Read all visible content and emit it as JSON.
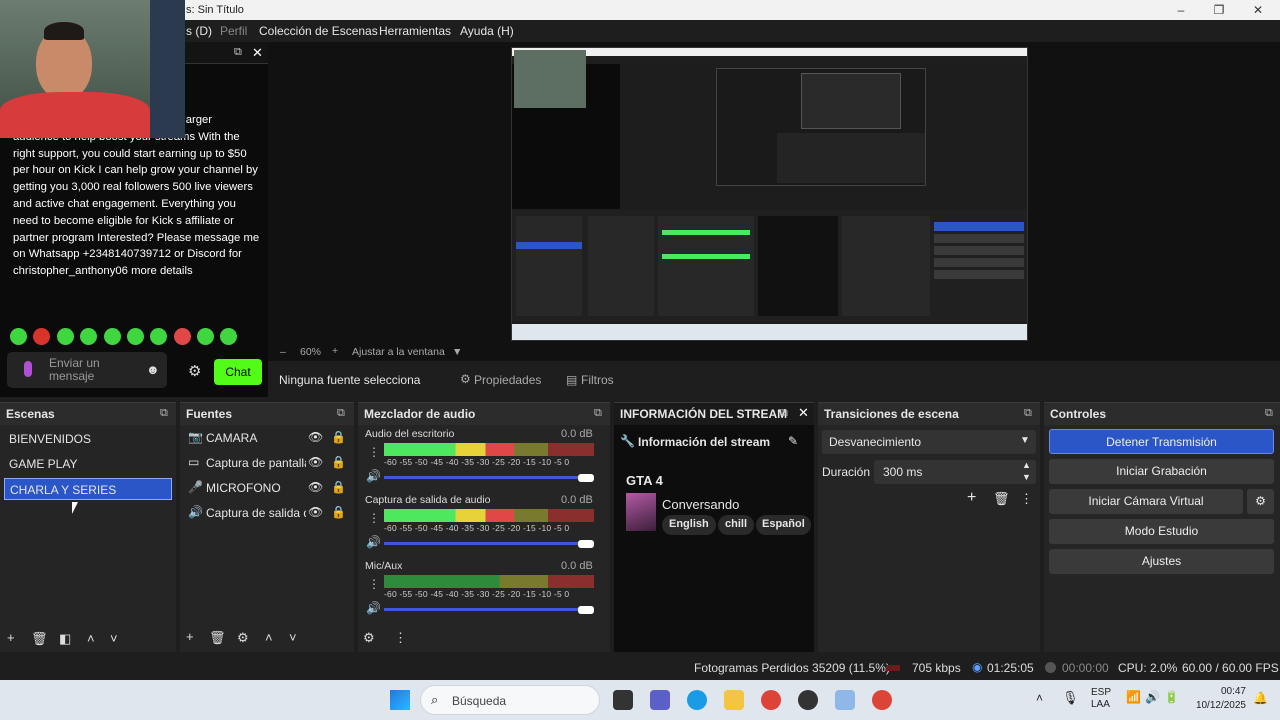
{
  "window": {
    "title": "s: Sin Título"
  },
  "menu": {
    "items": [
      "s (D)",
      "Perfil",
      "Colección de Escenas",
      "Herramientas",
      "Ayuda (H)"
    ]
  },
  "chat": {
    "message": "your channel could benefit from a larger audience to help boost your streams With the right support, you could start earning up to $50 per hour on Kick I can help grow your channel by getting you 3,000 real followers 500 live viewers and active chat engagement. Everything you need to become eligible for Kick s affiliate or partner program Interested? Please message me on Whatsapp +2348140739712 or Discord for christopher_anthony06 more details",
    "input_placeholder": "Enviar un mensaje",
    "send_label": "Chat"
  },
  "preview": {
    "zoom": "60%",
    "fit_label": "Ajustar a la ventana"
  },
  "source_toolbar": {
    "none_selected": "Ninguna fuente selecciona",
    "properties": "Propiedades",
    "filters": "Filtros"
  },
  "docks": {
    "scenes": {
      "title": "Escenas",
      "items": [
        "BIENVENIDOS",
        "GAME PLAY",
        "CHARLA Y SERIES"
      ],
      "selected": "CHARLA Y SERIES"
    },
    "sources": {
      "title": "Fuentes",
      "items": [
        {
          "name": "CAMARA",
          "icon": "camera-icon"
        },
        {
          "name": "Captura de pantalla",
          "icon": "monitor-icon"
        },
        {
          "name": "MICROFONO",
          "icon": "microphone-icon"
        },
        {
          "name": "Captura de salida d",
          "icon": "speaker-icon"
        }
      ]
    },
    "mixer": {
      "title": "Mezclador de audio",
      "channels": [
        {
          "name": "Audio del escritorio",
          "db": "0.0 dB",
          "level": 0.62
        },
        {
          "name": "Captura de salida de audio",
          "db": "0.0 dB",
          "level": 0.62
        },
        {
          "name": "Mic/Aux",
          "db": "0.0 dB",
          "level": 0.0
        }
      ],
      "ticks": "-60 -55 -50 -45 -40 -35 -30 -25 -20 -15 -10 -5 0"
    },
    "stream_info": {
      "title": "INFORMACIÓN DEL STREAM",
      "header": "Información del stream",
      "game": "GTA 4",
      "category": "Conversando",
      "tags": [
        "English",
        "chill",
        "Español"
      ]
    },
    "transitions": {
      "title": "Transiciones de escena",
      "transition": "Desvanecimiento",
      "duration_label": "Duración",
      "duration_value": "300 ms"
    },
    "controls": {
      "title": "Controles",
      "buttons": [
        "Detener Transmisión",
        "Iniciar Grabación",
        "Iniciar Cámara Virtual",
        "Modo Estudio",
        "Ajustes"
      ]
    }
  },
  "status": {
    "dropped": "Fotogramas Perdidos 35209 (11.5%)",
    "bitrate": "705 kbps",
    "live_time": "01:25:05",
    "rec_time": "00:00:00",
    "cpu": "CPU: 2.0%",
    "fps": "60.00 / 60.00 FPS"
  },
  "taskbar": {
    "search_placeholder": "Búsqueda",
    "lang": "ESP",
    "layout": "LAA",
    "time": "00:47",
    "date": "10/12/2025"
  },
  "colors": {
    "accent": "#2b56c7",
    "kick_green": "#53fc18",
    "panel": "#252526"
  }
}
